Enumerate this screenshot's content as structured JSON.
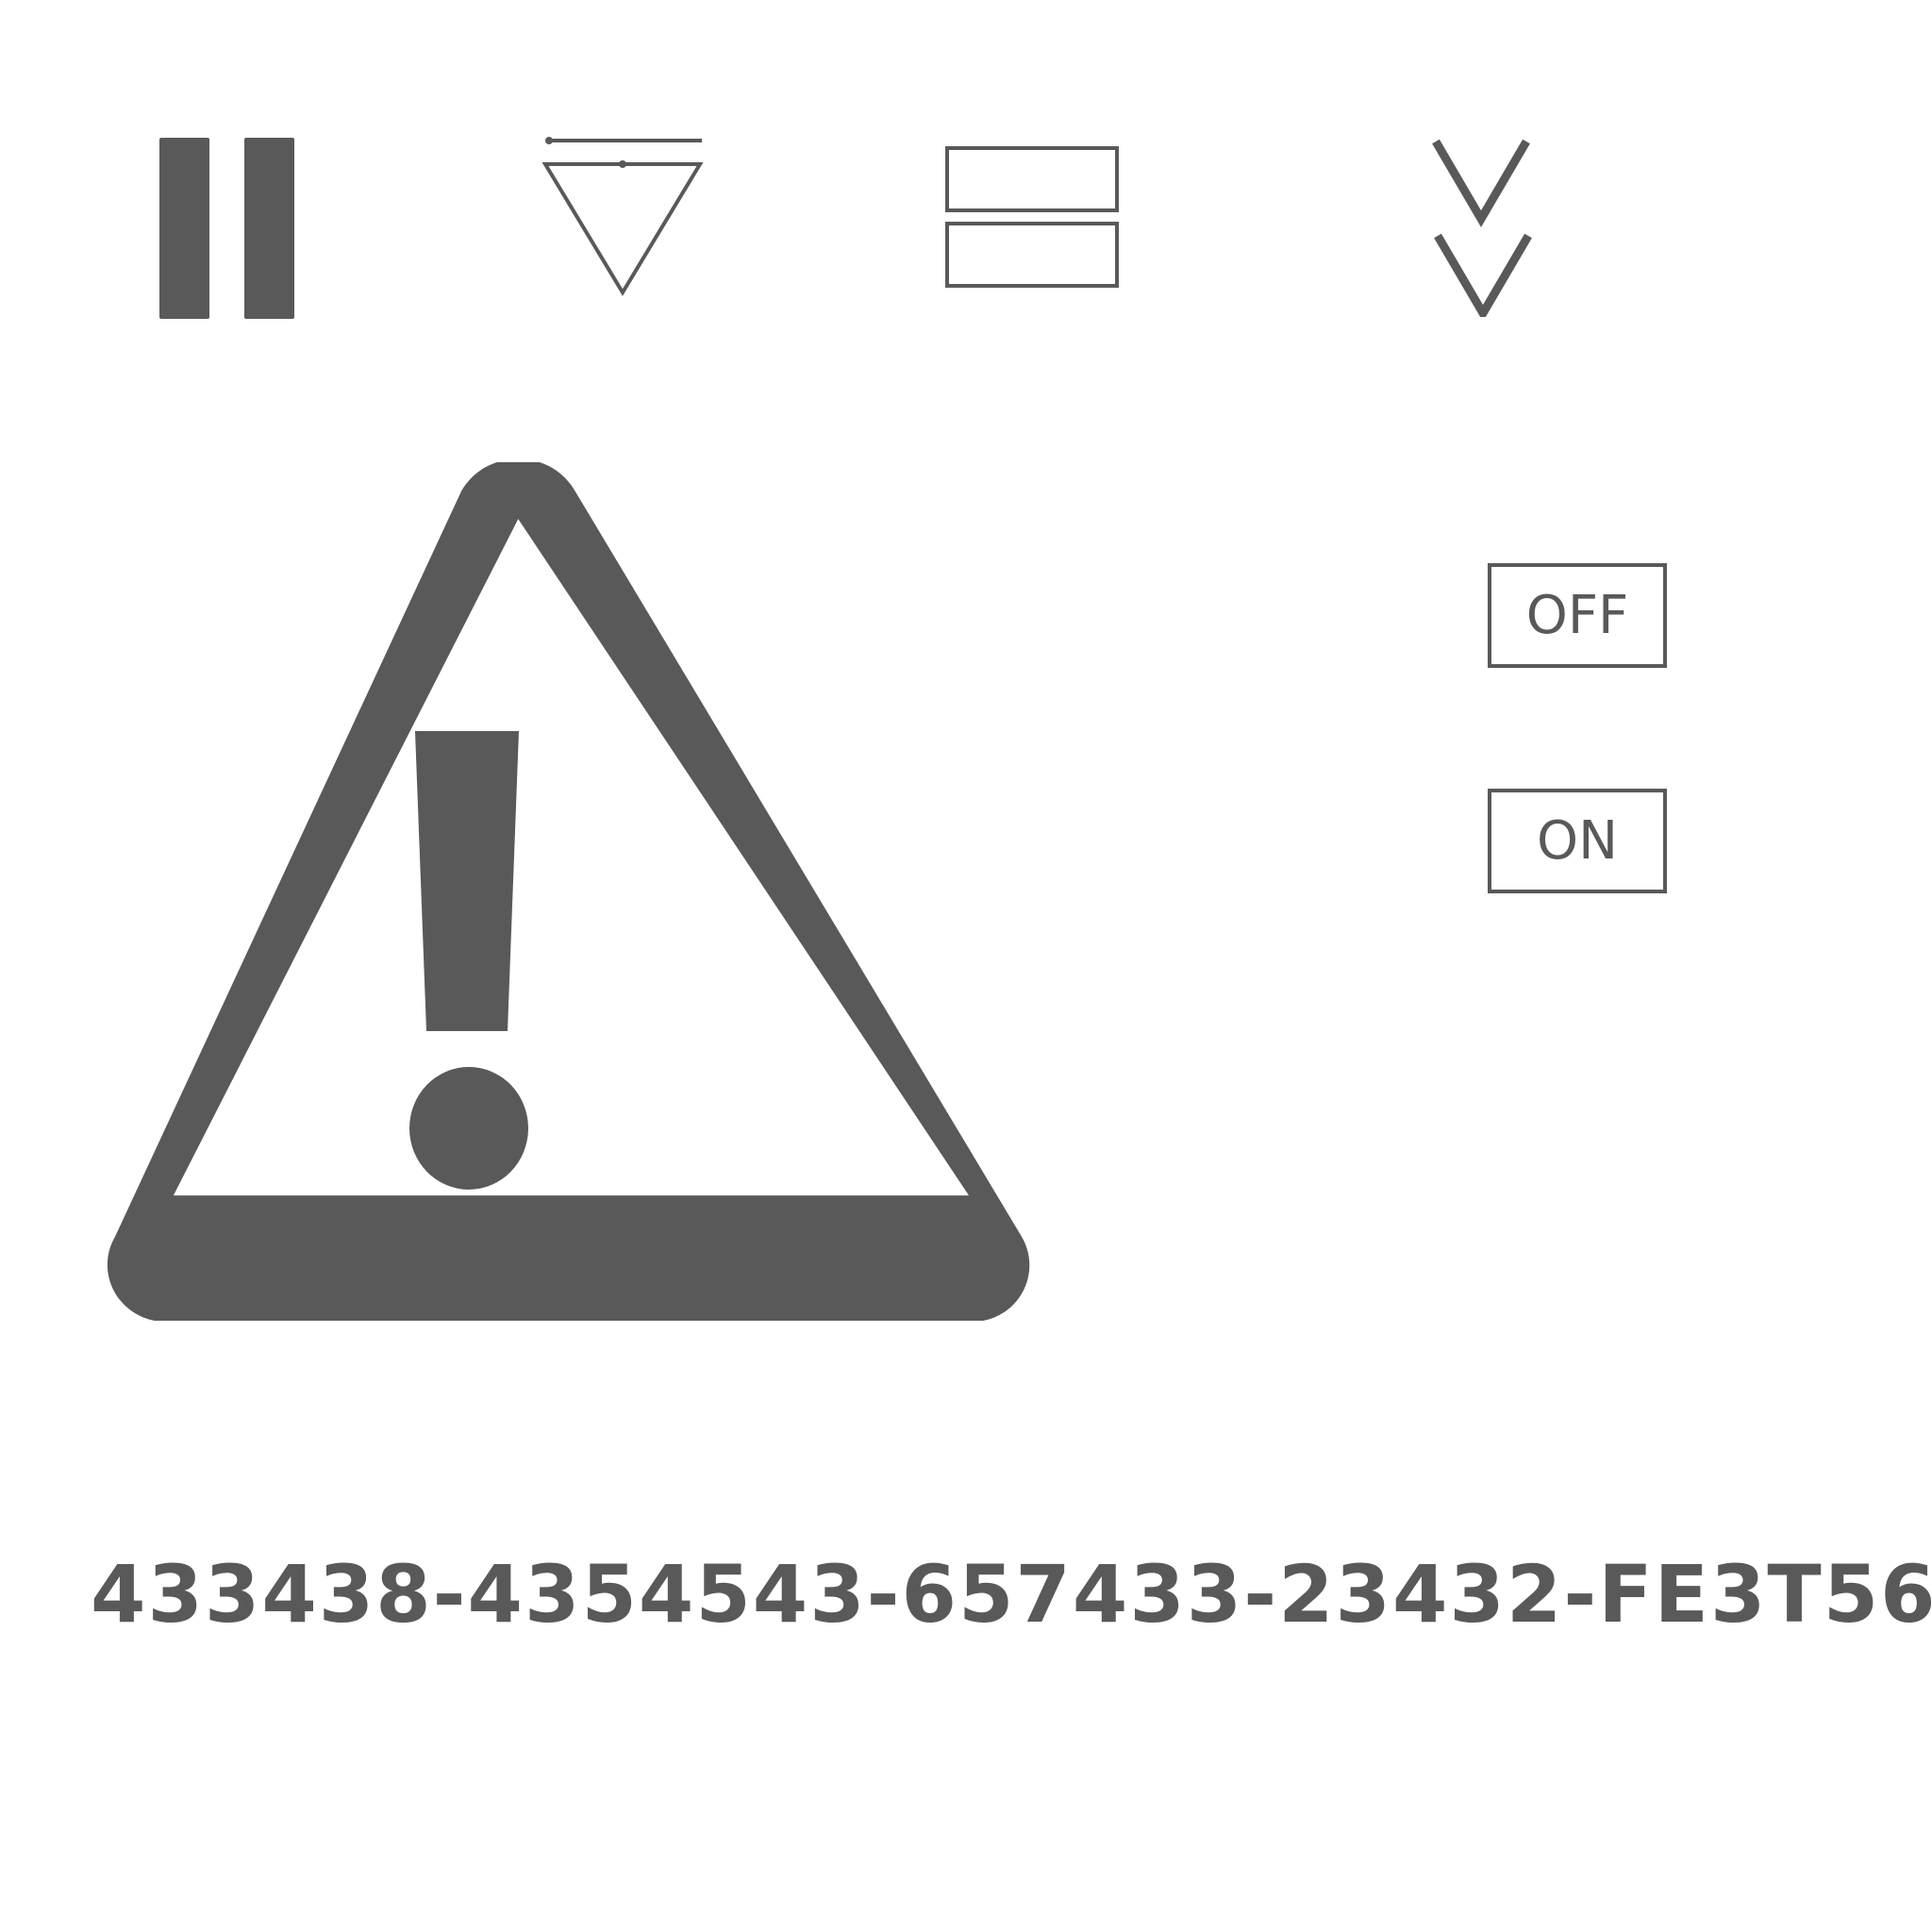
{
  "colors": {
    "foreground": "#595959",
    "background": "#ffffff"
  },
  "toolbar": {
    "icons": [
      "pause-icon",
      "triangle-down-bar-icon",
      "split-rows-icon",
      "double-chevron-down-icon"
    ]
  },
  "warning": {
    "icon": "warning-icon"
  },
  "toggles": {
    "off_label": "OFF",
    "on_label": "ON"
  },
  "code": {
    "text": "433438-4354543-657433-23432-FE3T56"
  }
}
